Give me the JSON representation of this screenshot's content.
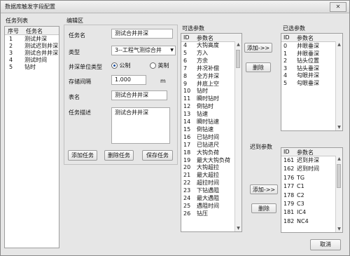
{
  "window": {
    "title": "数据库触发字段配置",
    "close_label": "✕"
  },
  "task_list": {
    "title": "任务列表",
    "headers": [
      "序号",
      "任务名"
    ],
    "rows": [
      {
        "no": "1",
        "name": "测试井深"
      },
      {
        "no": "2",
        "name": "测试迟到井深"
      },
      {
        "no": "3",
        "name": "测试合井井深"
      },
      {
        "no": "4",
        "name": "测试时间"
      },
      {
        "no": "5",
        "name": "钻时"
      }
    ]
  },
  "editor": {
    "title": "编辑区",
    "task_name_label": "任务名",
    "task_name_value": "测试合井井深",
    "type_label": "类型",
    "type_value": "3--工程气测综合井",
    "depth_unit_label": "井深单位类型",
    "unit_metric": "公制",
    "unit_imperial": "英制",
    "storage_label": "存储间隔",
    "storage_value": "1.000",
    "storage_unit": "m",
    "table_label": "表名",
    "table_value": "测试合井井深",
    "desc_label": "任务描述",
    "desc_value": "测试合井井深",
    "add_task": "添加任务",
    "delete_task": "删除任务",
    "save_task": "保存任务"
  },
  "available": {
    "title": "可选参数",
    "headers": [
      "ID",
      "参数名"
    ],
    "rows": [
      {
        "id": "4",
        "name": "大钩高度"
      },
      {
        "id": "5",
        "name": "方入"
      },
      {
        "id": "6",
        "name": "方余"
      },
      {
        "id": "7",
        "name": "井况补偿"
      },
      {
        "id": "8",
        "name": "全方井深"
      },
      {
        "id": "9",
        "name": "井底上空"
      },
      {
        "id": "10",
        "name": "钻时"
      },
      {
        "id": "11",
        "name": "瞬时钻时"
      },
      {
        "id": "12",
        "name": "倒钻时"
      },
      {
        "id": "13",
        "name": "钻速"
      },
      {
        "id": "14",
        "name": "瞬时钻速"
      },
      {
        "id": "15",
        "name": "倒钻速"
      },
      {
        "id": "16",
        "name": "已钻时间"
      },
      {
        "id": "17",
        "name": "已钻进尺"
      },
      {
        "id": "18",
        "name": "大钩负荷"
      },
      {
        "id": "19",
        "name": "最大大钩负荷"
      },
      {
        "id": "20",
        "name": "大钩超拉"
      },
      {
        "id": "21",
        "name": "最大超拉"
      },
      {
        "id": "22",
        "name": "超拉时间"
      },
      {
        "id": "23",
        "name": "下钻遇阻"
      },
      {
        "id": "24",
        "name": "最大遇阻"
      },
      {
        "id": "25",
        "name": "遇阻时间"
      },
      {
        "id": "26",
        "name": "钻压"
      }
    ]
  },
  "selected": {
    "title": "已选参数",
    "headers": [
      "ID",
      "参数名"
    ],
    "rows": [
      {
        "id": "0",
        "name": "井眼垂深"
      },
      {
        "id": "1",
        "name": "井眼垂深"
      },
      {
        "id": "2",
        "name": "钻头位置"
      },
      {
        "id": "3",
        "name": "钻头垂深"
      },
      {
        "id": "4",
        "name": "勾眼井深"
      },
      {
        "id": "5",
        "name": "勾眼垂深"
      }
    ]
  },
  "lag": {
    "title": "迟到参数",
    "headers": [
      "ID",
      "参数名"
    ],
    "rows": [
      {
        "id": "161",
        "name": "迟到井深"
      },
      {
        "id": "162",
        "name": "迟到时间"
      },
      {
        "id": "176",
        "name": "TG"
      },
      {
        "id": "177",
        "name": "C1"
      },
      {
        "id": "178",
        "name": "C2"
      },
      {
        "id": "179",
        "name": "C3"
      },
      {
        "id": "181",
        "name": "IC4"
      },
      {
        "id": "182",
        "name": "NC4"
      }
    ]
  },
  "buttons": {
    "add": "添加->>",
    "delete": "删除",
    "add_lag": "添加->>",
    "delete_lag": "删除",
    "cancel": "取消"
  },
  "colors": {
    "select_highlight": "#3399ff",
    "window_bg": "#e6e6e6"
  }
}
